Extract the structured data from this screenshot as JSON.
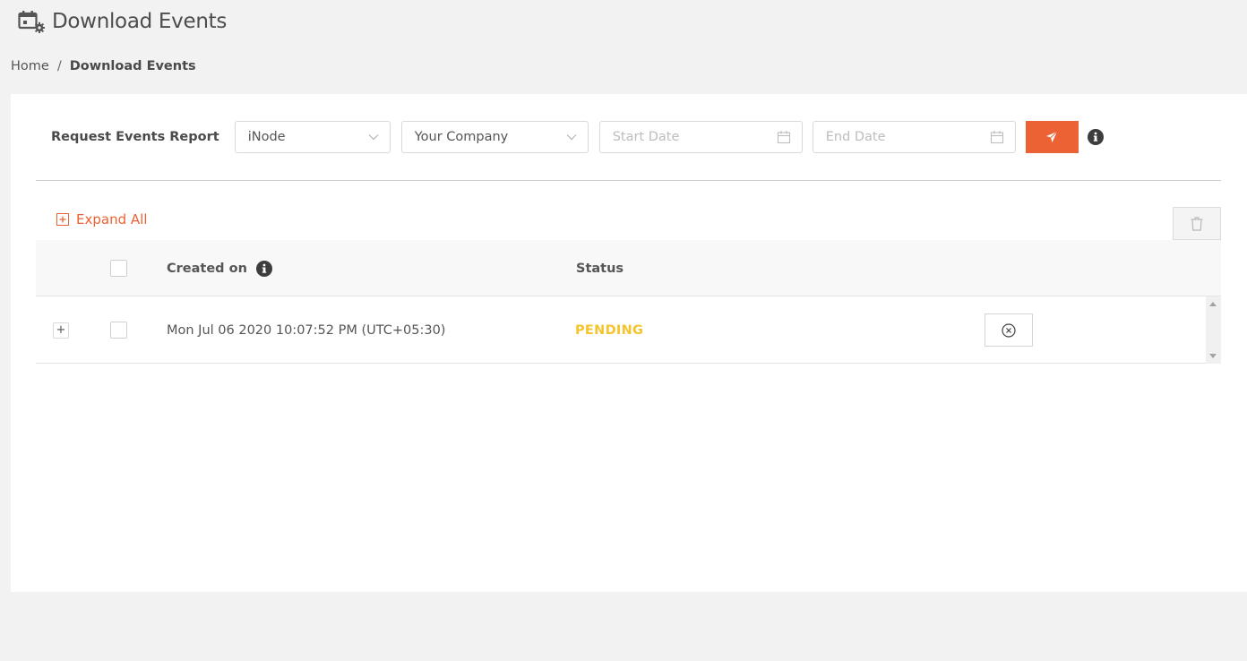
{
  "header": {
    "title": "Download Events",
    "icon": "calendar-gear-icon"
  },
  "breadcrumb": {
    "items": [
      "Home",
      "Download Events"
    ],
    "separator": "/"
  },
  "filters": {
    "label": "Request Events Report",
    "node_select": {
      "value": "iNode"
    },
    "company_select": {
      "value": "Your Company"
    },
    "start_date": {
      "value": "",
      "placeholder": "Start Date"
    },
    "end_date": {
      "value": "",
      "placeholder": "End Date"
    },
    "send_button": {
      "icon": "paper-plane-icon"
    },
    "info_icon": "info-circle-icon"
  },
  "toolbar": {
    "expand_all_label": "Expand All",
    "delete_icon": "trash-icon"
  },
  "table": {
    "columns": [
      "",
      "",
      "Created on",
      "Status",
      ""
    ],
    "rows": [
      {
        "created_on": "Mon Jul 06 2020 10:07:52 PM (UTC+05:30)",
        "status": "PENDING",
        "expand_symbol": "+",
        "action_icon": "cancel-circle-icon"
      }
    ]
  },
  "colors": {
    "accent": "#ec6234",
    "pending": "#f5c42c",
    "background": "#f2f2f2"
  }
}
